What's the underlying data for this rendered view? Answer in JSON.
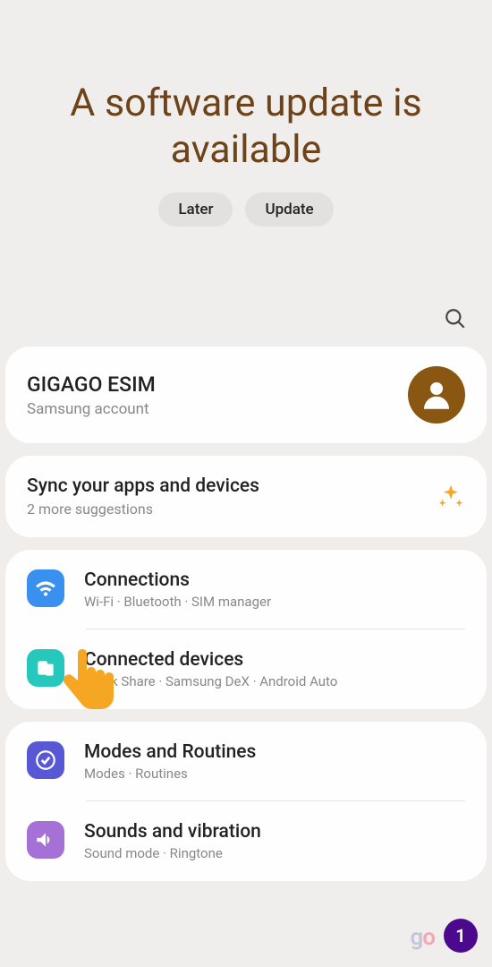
{
  "update_banner": {
    "title": "A software update is available",
    "later_label": "Later",
    "update_label": "Update"
  },
  "account": {
    "name": "GIGAGO ESIM",
    "subtitle": "Samsung account"
  },
  "sync_suggestion": {
    "title": "Sync your apps and devices",
    "subtitle": "2 more suggestions"
  },
  "settings": {
    "connections": {
      "title": "Connections",
      "subtitle": "Wi-Fi  ·  Bluetooth  ·  SIM manager"
    },
    "connected_devices": {
      "title": "Connected devices",
      "subtitle": "Quick Share  ·  Samsung DeX  ·  Android Auto"
    },
    "modes": {
      "title": "Modes and Routines",
      "subtitle": "Modes  ·  Routines"
    },
    "sounds": {
      "title": "Sounds and vibration",
      "subtitle": "Sound mode  ·  Ringtone"
    }
  },
  "badge_number": "1",
  "logo_text": "go"
}
